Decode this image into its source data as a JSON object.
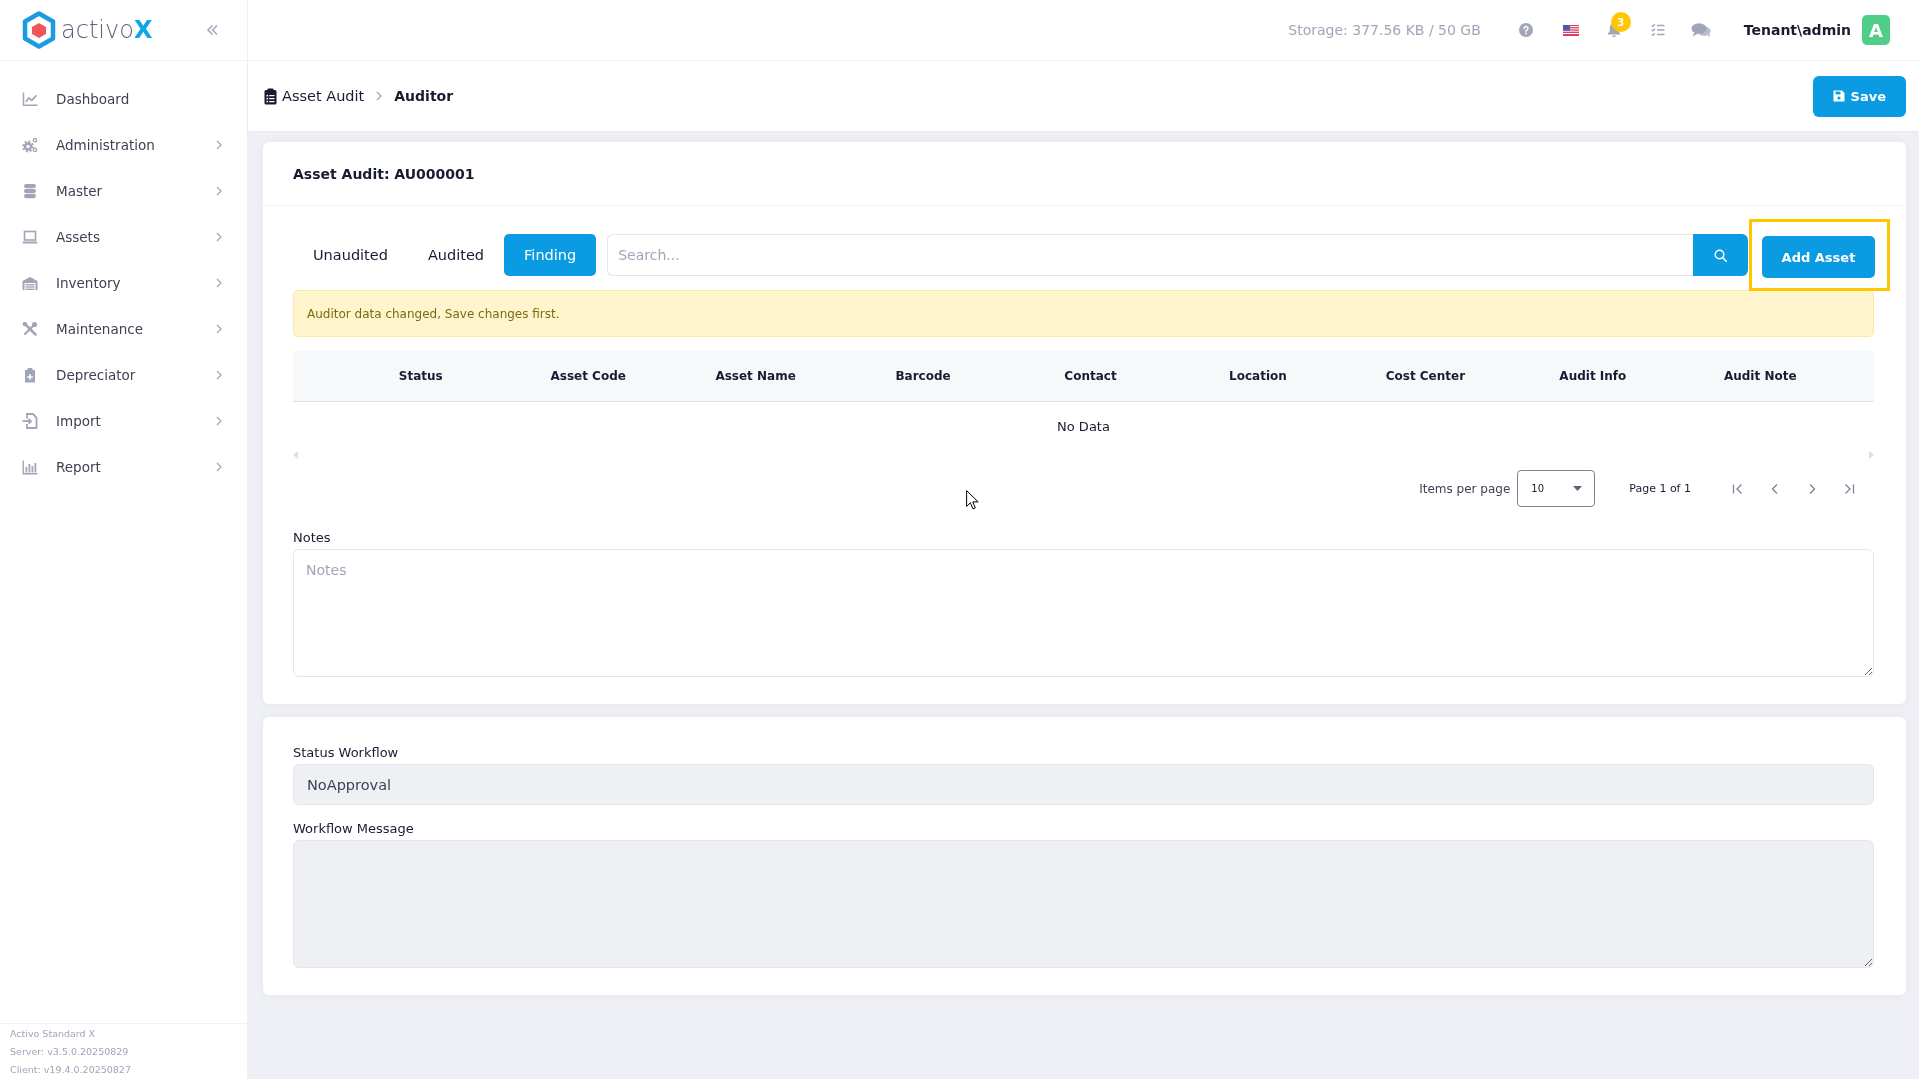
{
  "sidebar": {
    "brand": {
      "name": "activo",
      "accent": "X"
    },
    "items": [
      {
        "label": "Dashboard",
        "expandable": false
      },
      {
        "label": "Administration",
        "expandable": true
      },
      {
        "label": "Master",
        "expandable": true
      },
      {
        "label": "Assets",
        "expandable": true
      },
      {
        "label": "Inventory",
        "expandable": true
      },
      {
        "label": "Maintenance",
        "expandable": true
      },
      {
        "label": "Depreciator",
        "expandable": true
      },
      {
        "label": "Import",
        "expandable": true
      },
      {
        "label": "Report",
        "expandable": true
      }
    ],
    "footer": [
      "Activo Standard X",
      "Server: v3.5.0.20250829",
      "Client: v19.4.0.20250827"
    ]
  },
  "top_bar": {
    "storage": "Storage: 377.56 KB / 50 GB",
    "notification_count": "3",
    "user": "Tenant\\admin",
    "avatar": "A"
  },
  "breadcrumb": [
    {
      "label": "Asset Audit",
      "current": false
    },
    {
      "label": "Auditor",
      "current": true
    }
  ],
  "save_button": "Save",
  "audit_card": {
    "title": "Asset Audit: AU000001",
    "tabs": [
      {
        "label": "Unaudited",
        "selected": false
      },
      {
        "label": "Audited",
        "selected": false
      },
      {
        "label": "Finding",
        "selected": true
      }
    ],
    "search": {
      "placeholder": "Search..."
    },
    "add_asset": {
      "label": "Add Asset",
      "highlighted": true
    },
    "alert": "Auditor data changed, Save changes first.",
    "table": {
      "columns": [
        "Status",
        "Asset Code",
        "Asset Name",
        "Barcode",
        "Contact",
        "Location",
        "Cost Center",
        "Audit Info",
        "Audit Note"
      ],
      "empty_message": "No Data"
    },
    "pagination": {
      "items_per_page_label": "Items per page",
      "items_per_page": "10",
      "page_info": "Page 1 of 1"
    },
    "notes": {
      "label": "Notes",
      "placeholder": "Notes"
    }
  },
  "workflow_card": {
    "status_workflow": {
      "label": "Status Workflow",
      "value": "NoApproval",
      "disabled": true
    },
    "workflow_message": {
      "label": "Workflow Message",
      "disabled": true
    }
  }
}
